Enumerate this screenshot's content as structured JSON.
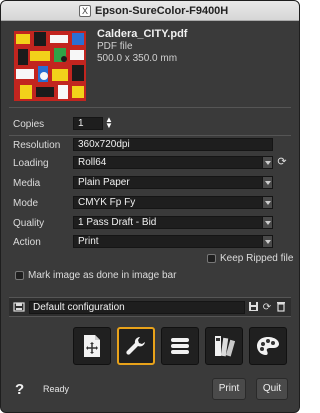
{
  "window": {
    "title": "Epson-SureColor-F9400H",
    "close_glyph": "X"
  },
  "file": {
    "name": "Caldera_CITY.pdf",
    "type": "PDF file",
    "size": "500.0 x 350.0 mm"
  },
  "settings": {
    "copies": {
      "label": "Copies",
      "value": "1"
    },
    "resolution": {
      "label": "Resolution",
      "value": "360x720dpi"
    },
    "loading": {
      "label": "Loading",
      "value": "Roll64"
    },
    "media": {
      "label": "Media",
      "value": "Plain Paper"
    },
    "mode": {
      "label": "Mode",
      "value": "CMYK Fp Fy"
    },
    "quality": {
      "label": "Quality",
      "value": "1 Pass Draft - Bid"
    },
    "action": {
      "label": "Action",
      "value": "Print"
    }
  },
  "options": {
    "keep_ripped": {
      "label": "Keep Ripped file",
      "checked": false
    },
    "mark_image": {
      "label": "Mark image as done in image bar",
      "checked": false
    }
  },
  "config": {
    "value": "Default configuration"
  },
  "toolbar": {
    "buttons": [
      {
        "icon": "document-move-icon",
        "active": false
      },
      {
        "icon": "wrench-icon",
        "active": true
      },
      {
        "icon": "list-icon",
        "active": false
      },
      {
        "icon": "color-swatches-icon",
        "active": false
      },
      {
        "icon": "palette-icon",
        "active": false
      }
    ],
    "active_color": "#e8a21a"
  },
  "footer": {
    "help": "?",
    "status": "Ready",
    "print_label": "Print",
    "quit_label": "Quit"
  }
}
